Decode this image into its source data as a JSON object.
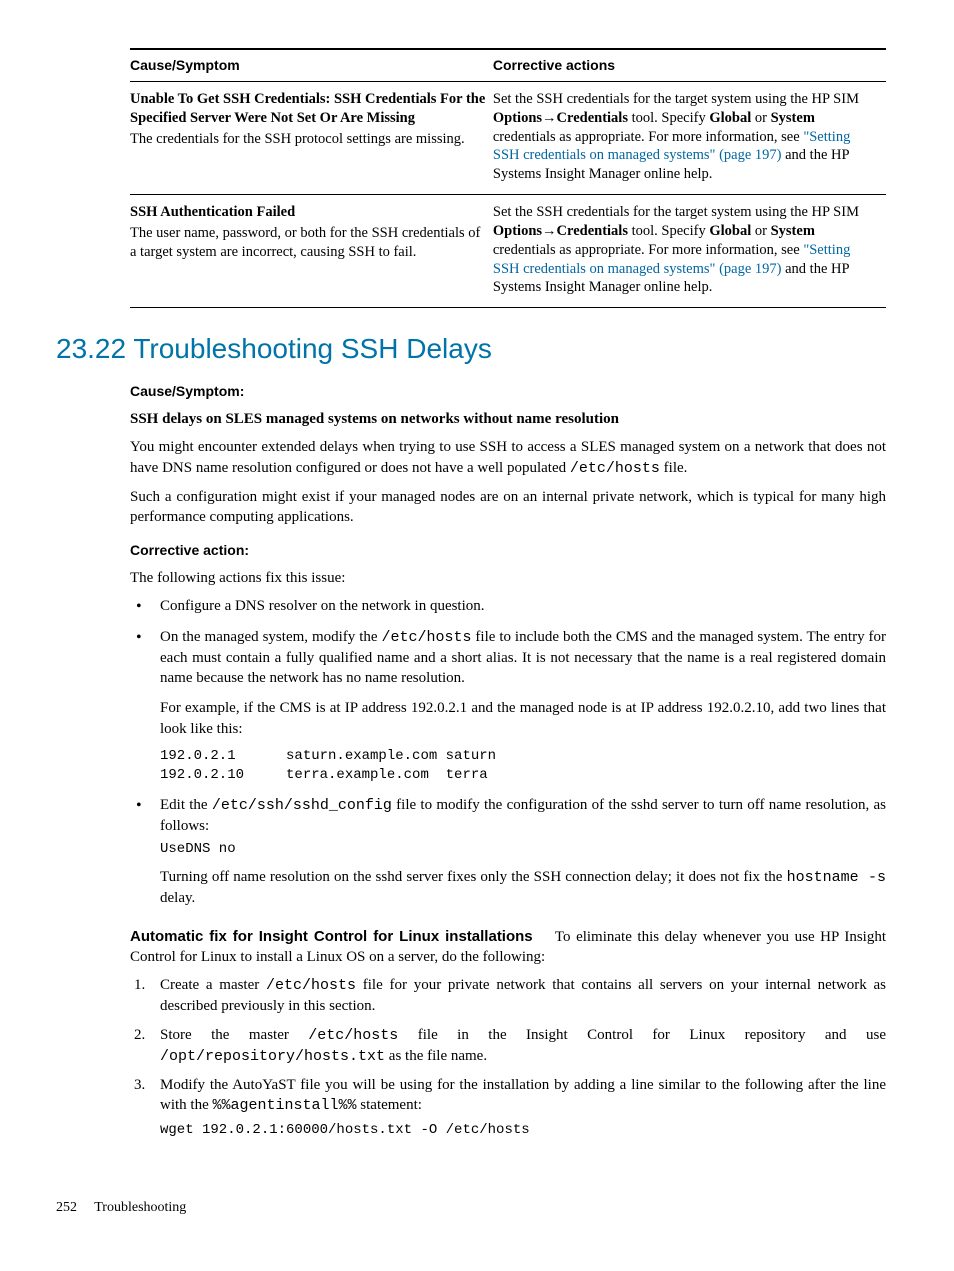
{
  "table": {
    "headers": {
      "cause": "Cause/Symptom",
      "action": "Corrective actions"
    },
    "rows": [
      {
        "title": "Unable To Get SSH Credentials: SSH Credentials For the Specified Server Were Not Set Or Are Missing",
        "desc": "The credentials for the SSH protocol settings are missing.",
        "action_pre": "Set the SSH credentials for the target system using the HP SIM ",
        "options": "Options",
        "arrow": "→",
        "credentials": "Credentials",
        "mid1": " tool. Specify ",
        "global": "Global",
        "or": " or ",
        "system": "System",
        "mid2": " credentials as appropriate. For more information, see ",
        "linktext": "\"Setting SSH credentials on managed systems\" (page 197)",
        "post": " and the HP Systems Insight Manager online help."
      },
      {
        "title": "SSH Authentication Failed",
        "desc": "The user name, password, or both for the SSH credentials of a target system are incorrect, causing SSH to fail.",
        "action_pre": "Set the SSH credentials for the target system using the HP SIM ",
        "options": "Options",
        "arrow": "→",
        "credentials": "Credentials",
        "mid1": " tool. Specify ",
        "global": "Global",
        "or": " or ",
        "system": "System",
        "mid2": " credentials as appropriate. For more information, see ",
        "linktext": "\"Setting SSH credentials on managed systems\" (page 197)",
        "post": " and the HP Systems Insight Manager online help."
      }
    ]
  },
  "section_title": "23.22 Troubleshooting SSH Delays",
  "labels": {
    "cause": "Cause/Symptom:",
    "corrective": "Corrective action:"
  },
  "symptom_title": "SSH delays on SLES managed systems on networks without name resolution",
  "para1": {
    "pre": "You might encounter extended delays when trying to use SSH to access a SLES managed system on a network that does not have DNS name resolution configured or does not have a well populated ",
    "code": "/etc/hosts",
    "post": " file."
  },
  "para2": "Such a configuration might exist if your managed nodes are on an internal private network, which is typical for many high performance computing applications.",
  "fix_intro": "The following actions fix this issue:",
  "bullets": {
    "b1": "Configure a DNS resolver on the network in question.",
    "b2": {
      "pre": "On the managed system, modify the ",
      "code": "/etc/hosts",
      "post": " file to include both the CMS and the managed system. The entry for each must contain a fully qualified name and a short alias. It is not necessary that the name is a real registered domain name because the network has no name resolution.",
      "example_lead": "For example, if the CMS is at IP address 192.0.2.1 and the managed node is at IP address 192.0.2.10, add two lines that look like this:",
      "code_block": "192.0.2.1      saturn.example.com saturn\n192.0.2.10     terra.example.com  terra"
    },
    "b3": {
      "pre": "Edit the ",
      "code1": "/etc/ssh/sshd_config",
      "mid": " file to modify the configuration of the sshd server to turn off name resolution, as follows:",
      "code_block": "UseDNS no",
      "after_pre": "Turning off name resolution on the sshd server fixes only the SSH connection delay; it does not fix the ",
      "code2": "hostname -s",
      "after_post": " delay."
    }
  },
  "autofix": {
    "title": "Automatic fix for Insight Control for Linux installations",
    "lead": "To eliminate this delay whenever you use HP Insight Control for Linux to install a Linux OS on a server, do the following:",
    "s1": {
      "pre": "Create a master ",
      "code": "/etc/hosts",
      "post": " file for your private network that contains all servers on your internal network as described previously in this section."
    },
    "s2": {
      "pre": "Store the master ",
      "code1": "/etc/hosts",
      "mid": " file in the Insight Control for Linux repository and use ",
      "code2": "/opt/repository/hosts.txt",
      "post": " as the file name."
    },
    "s3": {
      "pre": "Modify the AutoYaST file you will be using for the installation by adding a line similar to the following after the line with the ",
      "code1": "%%agentinstall%%",
      "mid": " statement:",
      "code_block": "wget 192.0.2.1:60000/hosts.txt -O /etc/hosts"
    }
  },
  "footer": {
    "page": "252",
    "title": "Troubleshooting"
  }
}
